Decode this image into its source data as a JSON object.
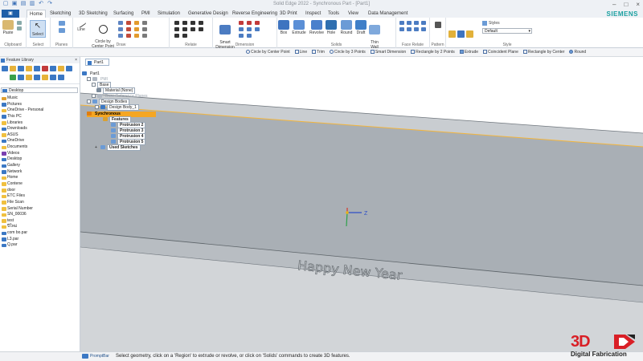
{
  "app": {
    "title": "Solid Edge 2022 - Synchronous Part - [Part1]",
    "brand": "SIEMENS"
  },
  "quick_access": [
    "new-file-icon",
    "save-icon",
    "open-icon",
    "print-icon",
    "undo-icon",
    "redo-icon"
  ],
  "tabs": [
    {
      "label": "Home",
      "active": true
    },
    {
      "label": "Sketching"
    },
    {
      "label": "3D Sketching"
    },
    {
      "label": "Surfacing"
    },
    {
      "label": "PMI"
    },
    {
      "label": "Simulation"
    },
    {
      "label": "Generative Design"
    },
    {
      "label": "Reverse Engineering"
    },
    {
      "label": "3D Print"
    },
    {
      "label": "Inspect"
    },
    {
      "label": "Tools"
    },
    {
      "label": "View"
    },
    {
      "label": "Data Management"
    }
  ],
  "ribbon": {
    "groups": {
      "clipboard": "Clipboard",
      "select": "Select",
      "planes": "Planes",
      "draw": "Draw",
      "relate": "Relate",
      "dimension": "Dimension",
      "solids": "Solids",
      "face_relate": "Face Relate",
      "pattern": "Pattern",
      "style": "Style"
    },
    "buttons": {
      "paste": "Paste",
      "select": "Select",
      "line": "Line",
      "circle": "Circle by\nCenter Point",
      "smart_dimension": "Smart\nDimension",
      "box": "Box",
      "extrude": "Extrude",
      "revolve": "Revolve",
      "hole": "Hole",
      "round": "Round",
      "draft": "Draft",
      "thin_wall": "Thin\nWall"
    },
    "styles_label": "Styles",
    "styles_value": "Default"
  },
  "command_bar": [
    "Circle by Center Point",
    "Line",
    "Trim",
    "Circle by 3 Points",
    "Smart Dimension",
    "Rectangle by 2 Points",
    "Extrude",
    "Coincident Plane",
    "Rectangle by Center",
    "Round"
  ],
  "feature_library": {
    "title": "Feature Library",
    "location": "Desktop",
    "folders": [
      {
        "label": "Music",
        "color": "#e0a030"
      },
      {
        "label": "Pictures",
        "color": "#3b78c4"
      },
      {
        "label": "OneDrive - Personal",
        "color": "#f0c040"
      },
      {
        "label": "This PC",
        "color": "#3b78c4"
      },
      {
        "label": "Libraries",
        "color": "#f0c040"
      },
      {
        "label": "Downloads",
        "color": "#3b78c4"
      },
      {
        "label": "ASUS",
        "color": "#f0c040"
      },
      {
        "label": "OneDrive",
        "color": "#3b78c4"
      },
      {
        "label": "Documents",
        "color": "#f0c040"
      },
      {
        "label": "Videos",
        "color": "#7a3fb0"
      },
      {
        "label": "Desktop",
        "color": "#3b78c4"
      },
      {
        "label": "Gallery",
        "color": "#3b78c4"
      },
      {
        "label": "Network",
        "color": "#3b78c4"
      },
      {
        "label": "Home",
        "color": "#f0c040"
      },
      {
        "label": "Contene",
        "color": "#f0c040"
      },
      {
        "label": "door",
        "color": "#f0c040"
      },
      {
        "label": "ETC Files",
        "color": "#f0c040"
      },
      {
        "label": "File Scan",
        "color": "#f0c040"
      },
      {
        "label": "Serial Number",
        "color": "#f0c040"
      },
      {
        "label": "SN_00036",
        "color": "#f0c040"
      },
      {
        "label": "test",
        "color": "#f0c040"
      },
      {
        "label": "ปีใหม่",
        "color": "#f0c040"
      },
      {
        "label": "com bo.par",
        "color": "#3b78c4"
      },
      {
        "label": "L3.par",
        "color": "#3b78c4"
      },
      {
        "label": "Q.par",
        "color": "#3b78c4"
      }
    ]
  },
  "document_tab": "Part1",
  "tree": {
    "root": "Part1",
    "pmi": "PMI",
    "base": "Base",
    "material": "Material (None)",
    "reference_planes": "Base Reference Planes",
    "design_bodies": "Design Bodies",
    "design_body_1": "Design Body_1",
    "synchronous": "Synchronous",
    "features": "Features",
    "protrusion_2": "Protrusion 2",
    "protrusion_3": "Protrusion 3",
    "protrusion_4": "Protrusion 4",
    "protrusion_5": "Protrusion 5",
    "used_sketches": "Used Sketches"
  },
  "model": {
    "engraved_text": "Happy New Year",
    "triad_z_label": "Z"
  },
  "status": {
    "prompt_label": "PromptBar",
    "prompt_text": "Select geometry, click on a 'Region' to extrude or revolve, or click on 'Solids' commands to create 3D features."
  },
  "logo": {
    "mark": "3D",
    "tagline": "Digital Fabrication"
  },
  "colors": {
    "accent": "#1f5fa8",
    "synchronous": "#f5a623",
    "logo_red": "#d91f26",
    "bar_face": "#a9afb5",
    "brand_teal": "#1aa0a0"
  }
}
